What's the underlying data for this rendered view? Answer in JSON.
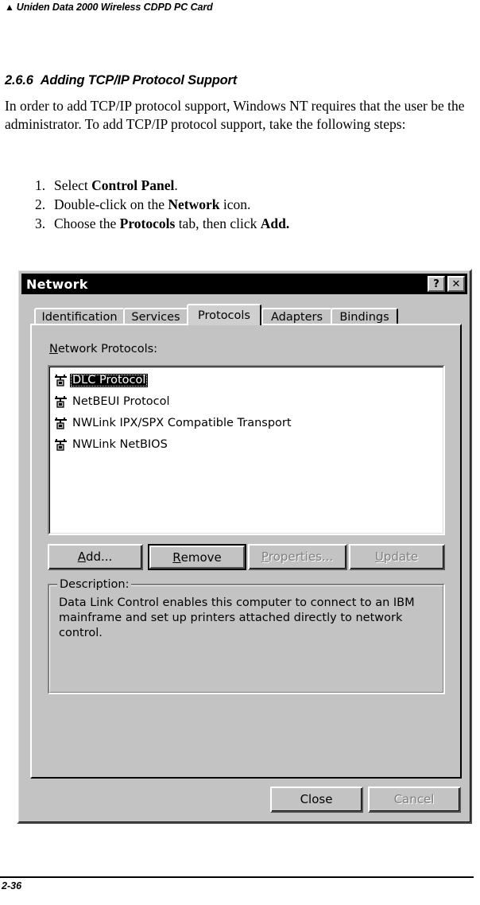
{
  "page": {
    "header_marker": "▲",
    "header_title": "Uniden Data 2000 Wireless CDPD PC Card",
    "footer_page": "2-36"
  },
  "document": {
    "section_number": "2.6.6",
    "section_title": "Adding TCP/IP Protocol Support",
    "paragraph_parts": {
      "p1": "In order to add TCP/IP protocol support, Windows NT requires that the user be the administrator. To add TCP/IP protocol support, take the following steps:"
    },
    "steps": [
      {
        "mark": "1.",
        "pre": "Select ",
        "bold": "Control Panel",
        "post": "."
      },
      {
        "mark": "2.",
        "pre": "Double-click on the ",
        "bold": "Network",
        "post": " icon."
      },
      {
        "mark": "3.",
        "pre": "Choose the ",
        "bold": "Protocols",
        "mid": " tab, then click ",
        "bold2": "Add.",
        "post": ""
      }
    ]
  },
  "dialog": {
    "title": "Network",
    "titlebar_help_label": "?",
    "titlebar_close_label": "✕",
    "tabs": [
      {
        "label": "Identification",
        "active": false
      },
      {
        "label": "Services",
        "active": false
      },
      {
        "label": "Protocols",
        "active": true
      },
      {
        "label": "Adapters",
        "active": false
      },
      {
        "label": "Bindings",
        "active": false
      }
    ],
    "list_label_accel": "N",
    "list_label_rest": "etwork Protocols:",
    "protocols": [
      {
        "name": "DLC Protocol",
        "selected": true,
        "icon": "network-protocol-icon"
      },
      {
        "name": "NetBEUI Protocol",
        "selected": false,
        "icon": "network-protocol-icon"
      },
      {
        "name": "NWLink IPX/SPX Compatible Transport",
        "selected": false,
        "icon": "network-protocol-icon"
      },
      {
        "name": "NWLink NetBIOS",
        "selected": false,
        "icon": "network-protocol-icon"
      }
    ],
    "action_buttons": [
      {
        "accel": "A",
        "rest": "dd...",
        "state": "normal"
      },
      {
        "accel": "R",
        "rest": "emove",
        "state": "default"
      },
      {
        "accel": "P",
        "rest": "roperties...",
        "state": "disabled"
      },
      {
        "accel": "U",
        "rest": "pdate",
        "state": "disabled"
      }
    ],
    "description": {
      "title": "Description:",
      "text": "Data Link Control enables this computer to connect to an IBM mainframe and set up printers attached directly to network control."
    },
    "bottom_buttons": [
      {
        "label": "Close",
        "state": "normal"
      },
      {
        "label": "Cancel",
        "state": "disabled"
      }
    ]
  },
  "colors": {
    "dialog_face": "#c3c3c3",
    "titlebar_bg": "#000000",
    "titlebar_fg": "#ffffff",
    "selection_bg": "#000000",
    "selection_fg": "#ffffff",
    "disabled_text": "#808080"
  }
}
